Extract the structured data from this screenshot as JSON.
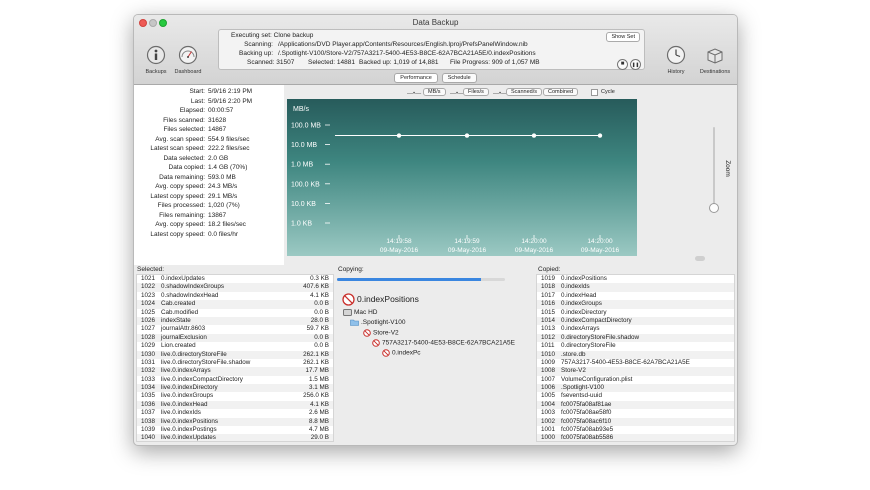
{
  "window": {
    "title": "Data Backup"
  },
  "toolbar": {
    "backups_label": "Backups",
    "dashboard_label": "Dashboard",
    "history_label": "History",
    "destinations_label": "Destinations",
    "show_set_label": "Show Set",
    "executing": "Executing set: Clone backup",
    "scanning_label": "Scanning:",
    "scanning_value": "/Applications/DVD Player.app/Contents/Resources/English.lproj/PrefsPanelWindow.nib",
    "backingup_label": "Backing up:",
    "backingup_value": "/.Spotlight-V100/Store-V2/757A3217-5400-4E53-B8CE-62A7BCA21A5E/0.indexPositions",
    "scanned": "Scanned: 31507",
    "selected": "Selected: 14881",
    "backedup": "Backed up: 1,019 of 14,881",
    "file_progress": "File Progress: 909 of 1,057 MB",
    "stop_glyph": "■",
    "pause_glyph": "❚❚"
  },
  "subtabs": {
    "performance": "Performance",
    "schedule": "Schedule"
  },
  "stats": [
    {
      "k": "Start:",
      "v": "5/9/16 2:19 PM"
    },
    {
      "k": "Last:",
      "v": "5/9/16 2:20 PM"
    },
    {
      "k": "Elapsed:",
      "v": "00:00:57"
    },
    {
      "k": "Files scanned:",
      "v": "31628"
    },
    {
      "k": "Files selected:",
      "v": "14867"
    },
    {
      "k": "Avg. scan speed:",
      "v": "554.9 files/sec"
    },
    {
      "k": "Latest scan speed:",
      "v": "222.2 files/sec"
    },
    {
      "k": "Data selected:",
      "v": "2.0 GB"
    },
    {
      "k": "Data copied:",
      "v": "1.4 GB (70%)"
    },
    {
      "k": "Data remaining:",
      "v": "593.0 MB"
    },
    {
      "k": "Avg. copy speed:",
      "v": "24.3 MB/s"
    },
    {
      "k": "Latest copy speed:",
      "v": "29.1 MB/s"
    },
    {
      "k": "Files processed:",
      "v": "1,020 (7%)"
    },
    {
      "k": "Files remaining:",
      "v": "13867"
    },
    {
      "k": "Avg. copy speed:",
      "v": "18.2 files/sec"
    },
    {
      "k": "Latest copy speed:",
      "v": "0.0 files/hr"
    }
  ],
  "legend": {
    "mbs": "MB/s",
    "files": "Files/s",
    "scanned": "Scanned/s",
    "combined": "Combined",
    "cycle": "Cycle"
  },
  "chart_data": {
    "type": "line",
    "ylabel": "MB/s",
    "yscale": "log",
    "yticks": [
      "100.0 MB",
      "10.0 MB",
      "1.0 MB",
      "100.0 KB",
      "10.0 KB",
      "1.0 KB"
    ],
    "x": [
      "14:19:58\n09-May-2016",
      "14:19:59\n09-May-2016",
      "14:20:00\n09-May-2016",
      "14:20:00\n09-May-2016"
    ],
    "x_time": [
      "14:19:58",
      "14:19:59",
      "14:20:00",
      "14:20:00"
    ],
    "x_date": [
      "09-May-2016",
      "09-May-2016",
      "09-May-2016",
      "09-May-2016"
    ],
    "series": [
      {
        "values_mb": [
          29,
          29,
          29,
          29
        ]
      }
    ],
    "colors": {
      "bg_top": "#275b5b",
      "bg_bottom": "#9bc9c3",
      "line": "#ffffff"
    }
  },
  "zoom_label": "Zoom",
  "selected": {
    "title": "Selected:",
    "rows": [
      [
        "1021",
        "0.indexUpdates",
        "0.3 KB"
      ],
      [
        "1022",
        "0.shadowIndexGroups",
        "407.6 KB"
      ],
      [
        "1023",
        "0.shadowIndexHead",
        "4.1 KB"
      ],
      [
        "1024",
        "Cab.created",
        "0.0 B"
      ],
      [
        "1025",
        "Cab.modified",
        "0.0 B"
      ],
      [
        "1026",
        "indexState",
        "28.0 B"
      ],
      [
        "1027",
        "journalAttr.8603",
        "59.7 KB"
      ],
      [
        "1028",
        "journalExclusion",
        "0.0 B"
      ],
      [
        "1029",
        "Lion.created",
        "0.0 B"
      ],
      [
        "1030",
        "live.0.directoryStoreFile",
        "262.1 KB"
      ],
      [
        "1031",
        "live.0.directoryStoreFile.shadow",
        "262.1 KB"
      ],
      [
        "1032",
        "live.0.indexArrays",
        "17.7 MB"
      ],
      [
        "1033",
        "live.0.indexCompactDirectory",
        "1.5 MB"
      ],
      [
        "1034",
        "live.0.indexDirectory",
        "3.1 MB"
      ],
      [
        "1035",
        "live.0.indexGroups",
        "256.0 KB"
      ],
      [
        "1036",
        "live.0.indexHead",
        "4.1 KB"
      ],
      [
        "1037",
        "live.0.indexIds",
        "2.6 MB"
      ],
      [
        "1038",
        "live.0.indexPositions",
        "8.8 MB"
      ],
      [
        "1039",
        "live.0.indexPostings",
        "4.7 MB"
      ],
      [
        "1040",
        "live.0.indexUpdates",
        "29.0 B"
      ]
    ]
  },
  "copying": {
    "title": "Copying:",
    "progress": 0.86,
    "current_file": "0.indexPositions",
    "tree": [
      "Mac HD",
      ".Spotlight-V100",
      "Store-V2",
      "757A3217-5400-4E53-B8CE-62A7BCA21A5E",
      "0.indexPc"
    ]
  },
  "copied": {
    "title": "Copied:",
    "rows": [
      [
        "1019",
        "0.indexPositions"
      ],
      [
        "1018",
        "0.indexIds"
      ],
      [
        "1017",
        "0.indexHead"
      ],
      [
        "1016",
        "0.indexGroups"
      ],
      [
        "1015",
        "0.indexDirectory"
      ],
      [
        "1014",
        "0.indexCompactDirectory"
      ],
      [
        "1013",
        "0.indexArrays"
      ],
      [
        "1012",
        "0.directoryStoreFile.shadow"
      ],
      [
        "1011",
        "0.directoryStoreFile"
      ],
      [
        "1010",
        ".store.db"
      ],
      [
        "1009",
        "757A3217-5400-4E53-B8CE-62A7BCA21A5E"
      ],
      [
        "1008",
        "Store-V2"
      ],
      [
        "1007",
        "VolumeConfiguration.plist"
      ],
      [
        "1006",
        ".Spotlight-V100"
      ],
      [
        "1005",
        "fseventsd-uuid"
      ],
      [
        "1004",
        "fc0075fa08af81ae"
      ],
      [
        "1003",
        "fc0075fa08ae58f0"
      ],
      [
        "1002",
        "fc0075fa08ac6f10"
      ],
      [
        "1001",
        "fc0075fa08ab93e5"
      ],
      [
        "1000",
        "fc0075fa08ab5586"
      ]
    ]
  }
}
